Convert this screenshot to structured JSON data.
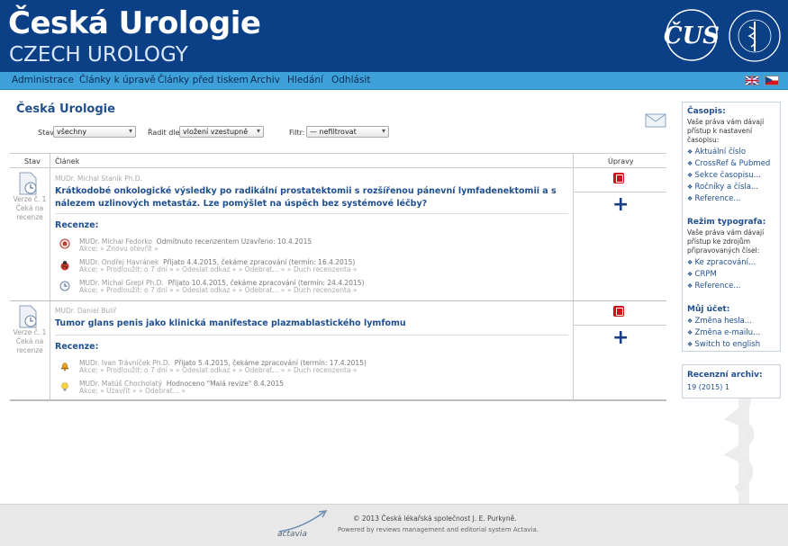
{
  "header": {
    "title": "Česká Urologie",
    "subtitle": "CZECH UROLOGY",
    "logo_text": "ČUS",
    "seal_text": "ČESKÁ LÉKAŘSKÁ SPOLEČNOST J. E. PURKYNĚ"
  },
  "nav": {
    "items": [
      "Administrace",
      "Články k úpravě",
      "Články před tiskem",
      "Archiv",
      "Hledání",
      "Odhlásit"
    ],
    "flags": [
      "english-flag-icon",
      "czech-flag-icon"
    ]
  },
  "main": {
    "title": "Česká Urologie",
    "filters": {
      "stav_label": "Stav:",
      "stav_value": "všechny",
      "radit_label": "Řadit dle:",
      "radit_value": "vložení vzestupně",
      "filtr_label": "Filtr:",
      "filtr_value": "— nefiltrovat"
    },
    "table": {
      "col_stav": "Stav",
      "col_clanek": "Článek",
      "col_upravy": "Úpravy",
      "articles": [
        {
          "version": "Verze č. 1",
          "status": "Čeká na recenze",
          "author": "MUDr. Michal Staník Ph.D.",
          "title": "Krátkodobé onkologické výsledky po radikální prostatektomii s rozšířenou pánevní lymfadenektomii a s nálezem uzlinových metastáz. Lze pomýšlet na úspěch bez systémové léčby?",
          "reviews_heading": "Recenze:",
          "reviews": [
            {
              "reviewer": "MUDr. Michal Fedorko",
              "status": "Odmítnuto recenzentem Uzavřeno: 10.4.2015",
              "actions": "Akce:   » Znovu otevřít »",
              "icon": "declined-icon"
            },
            {
              "reviewer": "MUDr. Ondřej Havránek",
              "status": "Přijato 4.4.2015, čekáme zpracování (termín: 16.4.2015)",
              "actions": "Akce:   » Prodloužit: o 7 dní »   » Odeslat odkaz »   » Odebrat... »   » Duch recenzenta »",
              "icon": "ladybug-icon"
            },
            {
              "reviewer": "MUDr. Michal Grepl Ph.D.",
              "status": "Přijato 10.4.2015, čekáme zpracování (termín: 24.4.2015)",
              "actions": "Akce:   » Prodloužit: o 7 dní »   » Odeslat odkaz »   » Odebrat... »   » Duch recenzenta »",
              "icon": "clock-icon"
            }
          ]
        },
        {
          "version": "Verze č. 1",
          "status": "Čeká na recenze",
          "author": "MUDr. Daniel Bulíř",
          "title": "Tumor glans penis jako klinická manifestace plazmablastického lymfomu",
          "reviews_heading": "Recenze:",
          "reviews": [
            {
              "reviewer": "MUDr. Ivan Trávníček Ph.D.",
              "status": "Přijato 5.4.2015, čekáme zpracování (termín: 17.4.2015)",
              "actions": "Akce:   » Prodloužit: o 7 dní »   » Odeslat odkaz »   » Odebrat... »   » Duch recenzenta »",
              "icon": "bell-icon"
            },
            {
              "reviewer": "MUDr. Matúš Chocholatý",
              "status": "Hodnoceno \"Malá revize\" 8.4.2015",
              "actions": "Akce:   » Uzavřít »   » Odebrat... »",
              "icon": "lightbulb-icon"
            }
          ]
        }
      ]
    }
  },
  "sidebar": {
    "casopis_heading": "Časopis:",
    "casopis_text": "Vaše práva vám dávají přístup k nastavení časopisu:",
    "casopis_links": [
      "Aktuální číslo",
      "CrossRef & Pubmed",
      "Sekce časopisu...",
      "Ročníky a čísla...",
      "Reference..."
    ],
    "typograf_heading": "Režim typografa:",
    "typograf_text": "Vaše práva vám dávají přístup ke zdrojům připravovaných čísel:",
    "typograf_links": [
      "Ke zpracování...",
      "CRPM",
      "Reference..."
    ],
    "ucet_heading": "Můj účet:",
    "ucet_links": [
      "Změna hesla...",
      "Změna e-mailu...",
      "Switch to english"
    ],
    "archiv_heading": "Recenzní archiv:",
    "archiv_text": "19 (2015) 1"
  },
  "footer": {
    "copyright": "© 2013 Česká lékařská společnost J. E. Purkyně.",
    "powered": "Powered by reviews management and editorial system Actavia.",
    "logo_text": "actavia"
  },
  "colors": {
    "header_bg": "#0b3f86",
    "nav_bg": "#3ea0d8",
    "link": "#1f4f8e",
    "pdf": "#c8141c"
  }
}
